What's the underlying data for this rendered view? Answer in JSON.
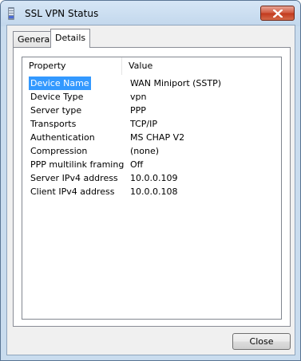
{
  "window": {
    "title": "SSL VPN Status",
    "icon": "network-icon"
  },
  "tabs": [
    {
      "label": "General",
      "selected": false
    },
    {
      "label": "Details",
      "selected": true
    }
  ],
  "details": {
    "columns": [
      "Property",
      "Value"
    ],
    "rows": [
      {
        "property": "Device Name",
        "value": "WAN Miniport (SSTP)",
        "selected": true
      },
      {
        "property": "Device Type",
        "value": "vpn"
      },
      {
        "property": "Server type",
        "value": "PPP"
      },
      {
        "property": "Transports",
        "value": "TCP/IP"
      },
      {
        "property": "Authentication",
        "value": "MS CHAP V2"
      },
      {
        "property": "Compression",
        "value": "(none)"
      },
      {
        "property": "PPP multilink framing",
        "value": "Off"
      },
      {
        "property": "Server IPv4 address",
        "value": "10.0.0.109"
      },
      {
        "property": "Client IPv4 address",
        "value": "10.0.0.108"
      }
    ]
  },
  "buttons": {
    "close_label": "Close"
  },
  "colors": {
    "selection": "#3399ff",
    "titlebar": "#c9dcee",
    "close_button": "#c1381c"
  }
}
